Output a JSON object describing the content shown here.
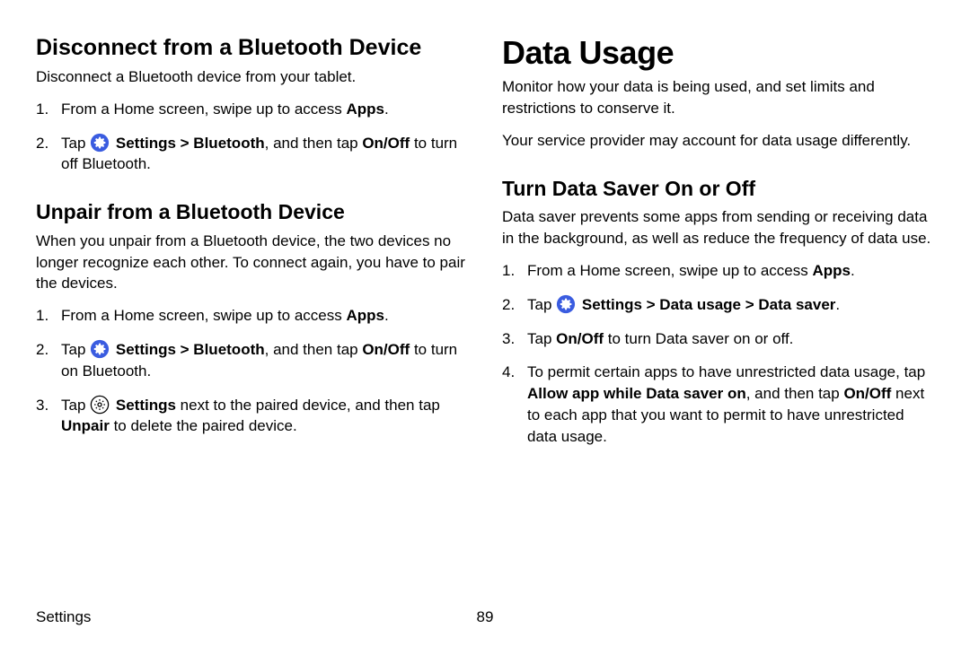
{
  "left": {
    "section1": {
      "heading": "Disconnect from a Bluetooth Device",
      "intro": "Disconnect a Bluetooth device from your tablet.",
      "step1_a": "From a Home screen, swipe up to access ",
      "step1_b": "Apps",
      "step1_c": ".",
      "step2_a": "Tap ",
      "step2_b": "Settings > Bluetooth",
      "step2_c": ", and then tap ",
      "step2_d": "On/Off",
      "step2_e": " to turn off Bluetooth."
    },
    "section2": {
      "heading": "Unpair from a Bluetooth Device",
      "intro": "When you unpair from a Bluetooth device, the two devices no longer recognize each other. To connect again, you have to pair the devices.",
      "step1_a": "From a Home screen, swipe up to access ",
      "step1_b": "Apps",
      "step1_c": ".",
      "step2_a": "Tap ",
      "step2_b": "Settings > Bluetooth",
      "step2_c": ", and then tap ",
      "step2_d": "On/Off",
      "step2_e": " to turn on Bluetooth.",
      "step3_a": "Tap ",
      "step3_b": "Settings",
      "step3_c": " next to the paired device, and then tap ",
      "step3_d": "Unpair",
      "step3_e": " to delete the paired device."
    }
  },
  "right": {
    "title": "Data Usage",
    "intro1": "Monitor how your data is being used, and set limits and restrictions to conserve it.",
    "intro2": "Your service provider may account for data usage differently.",
    "section1": {
      "heading": "Turn Data Saver On or Off",
      "intro": "Data saver prevents some apps from sending or receiving data in the background, as well as reduce the frequency of data use.",
      "step1_a": "From a Home screen, swipe up to access ",
      "step1_b": "Apps",
      "step1_c": ".",
      "step2_a": "Tap ",
      "step2_b": "Settings > Data usage > Data saver",
      "step2_c": ".",
      "step3_a": "Tap ",
      "step3_b": "On/Off",
      "step3_c": " to turn Data saver on or off.",
      "step4_a": "To permit certain apps to have unrestricted data usage, tap ",
      "step4_b": "Allow app while Data saver on",
      "step4_c": ", and then tap ",
      "step4_d": "On/Off",
      "step4_e": " next to each app that you want to permit to have unrestricted data usage."
    }
  },
  "footer": {
    "section": "Settings",
    "page": "89"
  },
  "colors": {
    "accent": "#3a5ce0"
  }
}
